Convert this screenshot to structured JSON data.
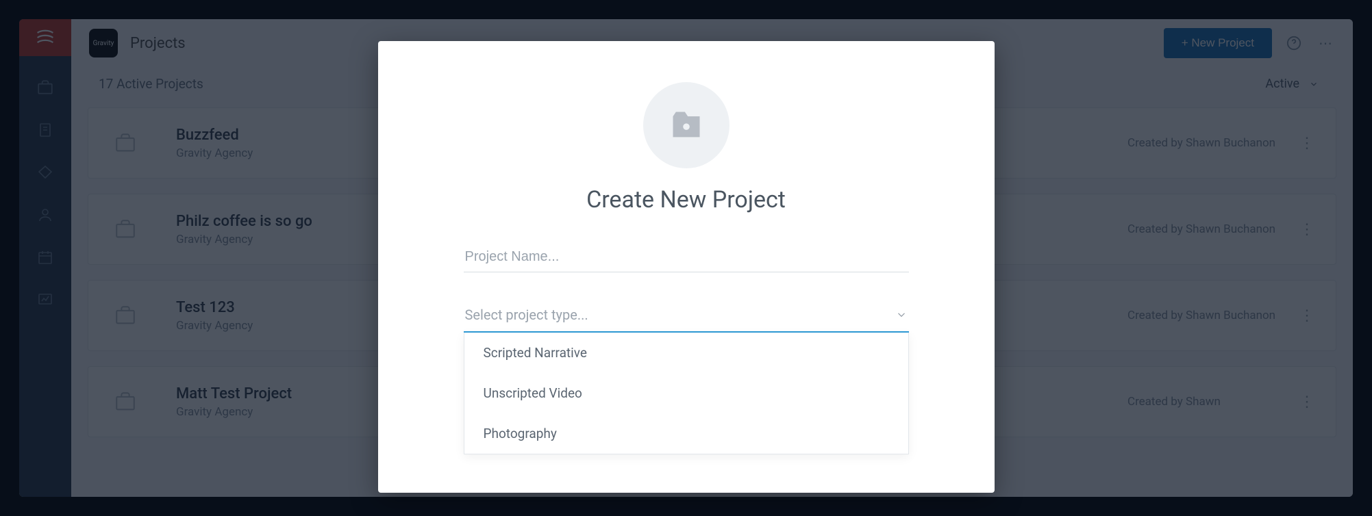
{
  "header": {
    "breadcrumb": "Projects",
    "new_project_btn": "+ New Project",
    "workspace_short": "Gravity"
  },
  "subheader": {
    "count_text": "17 Active Projects",
    "filter_label": "Active"
  },
  "projects": [
    {
      "title": "Buzzfeed",
      "agency": "Gravity Agency",
      "meta": "Created by Shawn Buchanon"
    },
    {
      "title": "Philz coffee is so go",
      "agency": "Gravity Agency",
      "meta": "Created by Shawn Buchanon"
    },
    {
      "title": "Test 123",
      "agency": "Gravity Agency",
      "meta": "Created by Shawn Buchanon"
    },
    {
      "title": "Matt Test Project",
      "agency": "Gravity Agency",
      "meta": "Created by Shawn"
    }
  ],
  "modal": {
    "title": "Create New Project",
    "name_placeholder": "Project Name...",
    "type_placeholder": "Select project type...",
    "options": {
      "opt0": "Scripted Narrative",
      "opt1": "Unscripted Video",
      "opt2": "Photography"
    }
  }
}
